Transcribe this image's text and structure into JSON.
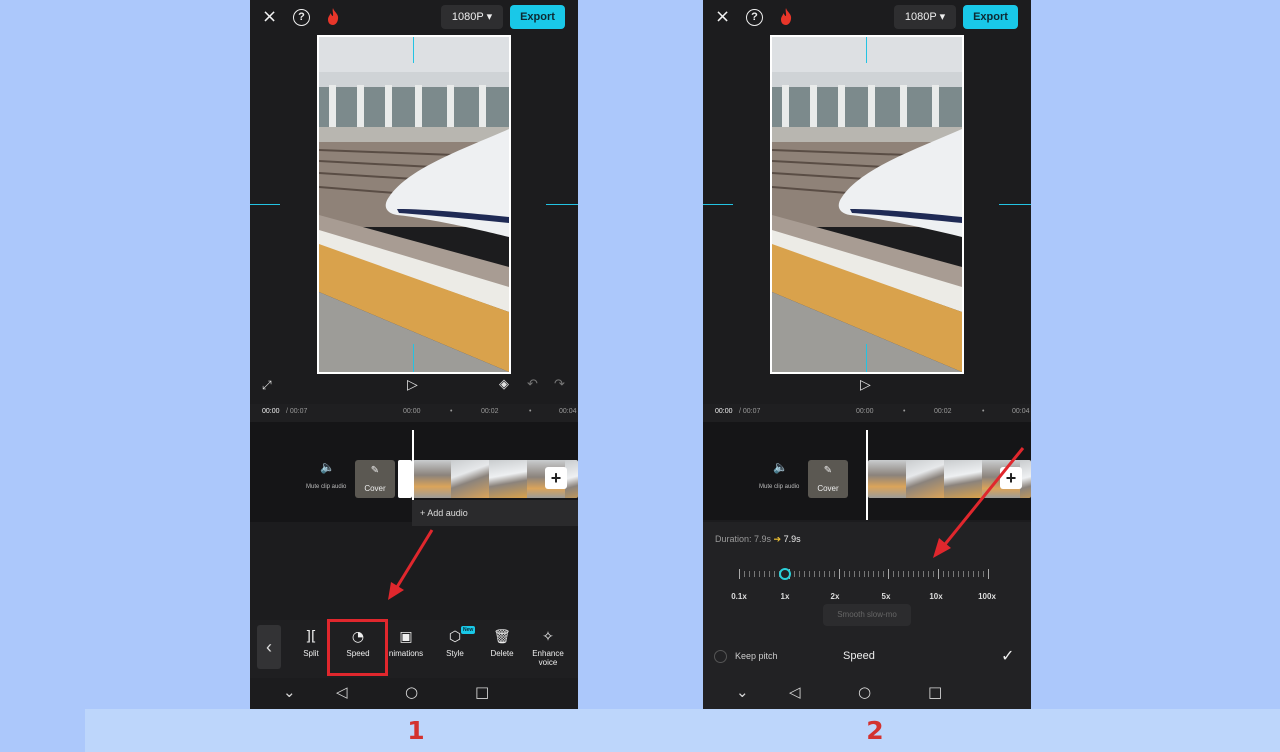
{
  "colors": {
    "background": "#acc8fb",
    "accent": "#19c8e8",
    "highlight_red": "#e0272d",
    "step_number": "#d3322f"
  },
  "steps": [
    "1",
    "2"
  ],
  "phone1": {
    "topbar": {
      "close_icon": "×",
      "help_icon": "?",
      "resolution": "1080P ▾",
      "export": "Export"
    },
    "ruler": {
      "current": "00:00",
      "total": "/ 00:07",
      "marks": [
        "00:00",
        "•",
        "00:02",
        "•",
        "00:04"
      ]
    },
    "timeline": {
      "mute_label": "Mute clip audio",
      "cover_label": "Cover",
      "add_audio": "+ Add audio"
    },
    "toolbar": {
      "items": [
        {
          "label": "Split",
          "icon": "split-icon"
        },
        {
          "label": "Speed",
          "icon": "speed-icon"
        },
        {
          "label": "nimations",
          "icon": "animations-icon"
        },
        {
          "label": "Style",
          "icon": "style-icon",
          "badge": "New"
        },
        {
          "label": "Delete",
          "icon": "delete-icon"
        },
        {
          "label": "Enhance voice",
          "icon": "enhance-voice-icon"
        }
      ],
      "highlighted": "Speed"
    }
  },
  "phone2": {
    "topbar": {
      "close_icon": "×",
      "help_icon": "?",
      "resolution": "1080P ▾",
      "export": "Export"
    },
    "ruler": {
      "current": "00:00",
      "total": "/ 00:07",
      "marks": [
        "00:00",
        "•",
        "00:02",
        "•",
        "00:04"
      ]
    },
    "timeline": {
      "mute_label": "Mute clip audio",
      "cover_label": "Cover"
    },
    "speed_panel": {
      "duration_label": "Duration: 7.9s",
      "duration_arrow": "➔",
      "duration_new": "7.9s",
      "speed_labels": [
        "0.1x",
        "1x",
        "2x",
        "5x",
        "10x",
        "100x"
      ],
      "current_speed": "1x",
      "smooth": "Smooth slow-mo",
      "keep_pitch": "Keep pitch",
      "title": "Speed",
      "confirm_icon": "✓"
    }
  }
}
